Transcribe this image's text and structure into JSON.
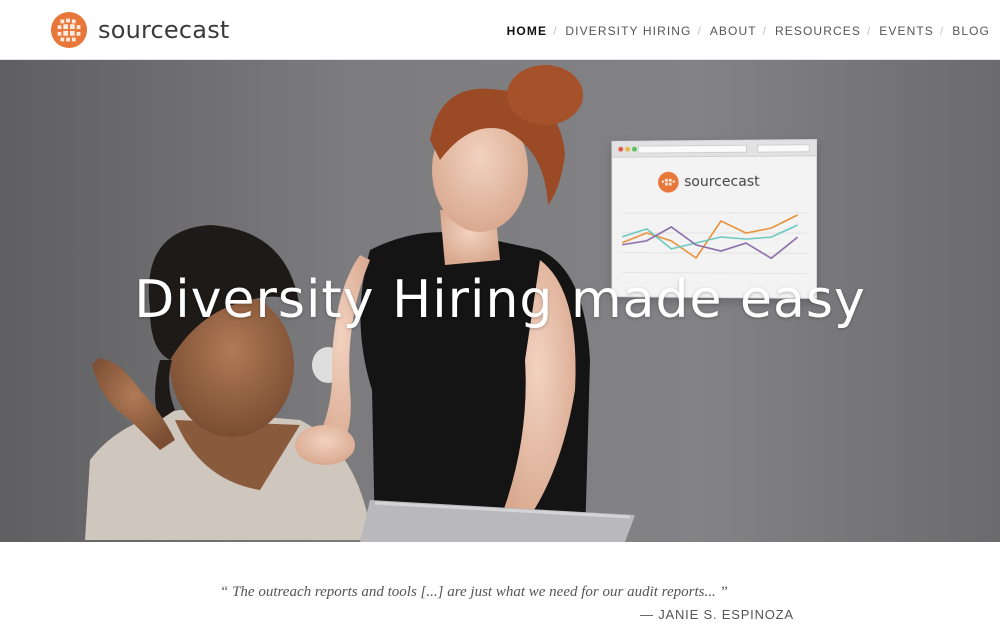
{
  "brand": {
    "name": "sourcecast",
    "accent_color": "#e8773a"
  },
  "nav": {
    "items": [
      {
        "label": "HOME",
        "active": true
      },
      {
        "label": "DIVERSITY HIRING",
        "active": false
      },
      {
        "label": "ABOUT",
        "active": false
      },
      {
        "label": "RESOURCES",
        "active": false
      },
      {
        "label": "EVENTS",
        "active": false
      },
      {
        "label": "BLOG",
        "active": false
      }
    ],
    "separator": "/"
  },
  "hero": {
    "title": "Diversity Hiring made easy",
    "card": {
      "logo_text": "sourcecast",
      "line_colors": [
        "#e8913a",
        "#6ac8c0",
        "#8a6aa8"
      ]
    }
  },
  "testimonial": {
    "quote": "“ The outreach reports and tools [...] are just what we need for our audit reports... ”",
    "author": "— JANIE S. ESPINOZA"
  }
}
